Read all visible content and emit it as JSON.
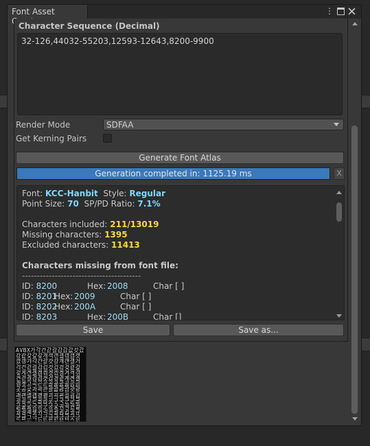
{
  "window": {
    "title": "Font Asset Creator",
    "menu_icon": "kebab-menu-icon",
    "maximize_icon": "maximize-icon",
    "close_icon": "close-icon"
  },
  "character_sequence": {
    "label": "Character Sequence (Decimal)",
    "value": "32-126,44032-55203,12593-12643,8200-9900"
  },
  "render_mode": {
    "label": "Render Mode",
    "value": "SDFAA"
  },
  "kerning": {
    "label": "Get Kerning Pairs",
    "checked": false
  },
  "generate_button": "Generate Font Atlas",
  "progress": {
    "text": "Generation completed in: 1125.19 ms",
    "fraction": 1.0,
    "close": "X"
  },
  "info": {
    "font_label": "Font:",
    "font_value": "KCC-Hanbit",
    "style_label": "Style:",
    "style_value": "Regular",
    "point_size_label": "Point Size:",
    "point_size_value": "70",
    "ratio_label": "SP/PD Ratio:",
    "ratio_value": "7.1%",
    "included_label": "Characters included:",
    "included_value": "211/13019",
    "missing_label": "Missing characters:",
    "missing_value": "1395",
    "excluded_label": "Excluded characters:",
    "excluded_value": "11413",
    "missing_header": "Characters missing from font file:",
    "separator": "----------------------------------------",
    "rows": [
      {
        "id_label": "ID:",
        "id": "8200",
        "hex_label": "Hex:",
        "hex": "2008",
        "char": "Char [ ]"
      },
      {
        "id_label": "ID:",
        "id": "8201",
        "hex_label": "Hex:",
        "hex": "2009",
        "char": "Char [ ]"
      },
      {
        "id_label": "ID:",
        "id": "8202",
        "hex_label": "Hex:",
        "hex": "200A",
        "char": "Char [ ]"
      },
      {
        "id_label": "ID:",
        "id": "8203",
        "hex_label": "Hex:",
        "hex": "200B",
        "char": "Char []"
      }
    ]
  },
  "save_button": "Save",
  "save_as_button": "Save as...",
  "atlas_preview_glyphs": "AVBX가각간갇갈감갑값갓갔강같갖갚갛개객갠갤갬갭갯갰갱갸갹갼걀걋걍걔걘걜거걱건걷걸검겁것겄겅겆겉겊겋게겐겔겜겝겟겠겡겨격겪견겯결겸겹겻겼경곁계곈곌곕곗고곡곤곧골곪곬곯곰곱곳공곶과곽관괄괆괌괍괏광괘괜괠괩괬괭괴괵괸괼굄굅굇굉교굔굘굡굣구국군굳굴굵굶굻굼굽굿궁궂궈궉권궐궜궝궤궷귀귁귄귈귐귑귓규균귤그극근귿글긁금급긋긍긔기긱긴긷길긺김깁깃깅깆깊까깍깎깐깔깖깜깝깟깠깡깥깨깩깬깰깸깹깻깼깽꺄꺅꺌꺼꺽꺾껀껄껌껍껏껐껑께껙껜껨껫껭껴껸껼꼇꼈꼍꼐꼬꼭꼰꼲꼴꼼꼽꼿꽁꽂꽃꽈꽉꽐꽜꽝꽤꽥꽹꾀꾄꾈꾐꾑꾕꾜꾸꾹꾼꿀꿇꿈꿉꿋꿍꿎꿔꿜꿨꿩꿰꿱꿴꿸뀀뀁뀄뀌뀐뀔뀜뀝뀨끄끅끈끊끌끎끓끔끕끗끙끝끼끽낀낄낌낍낏낑나낙낚난낟날낡낢남납낫났낭낮낯낱낳내낵낸낼냄냅냇냈냉냐냑냔냘냠냥너넉넋넌널넒넓넘넙넛넜넝넣네넥넨넬넴넵넷넸넹녀녁년녈념녑녔녕녘녜녠노녹논놀놂놈놉놋농높놓놔놘놜놨뇌뇐뇔뇜뇝"
}
